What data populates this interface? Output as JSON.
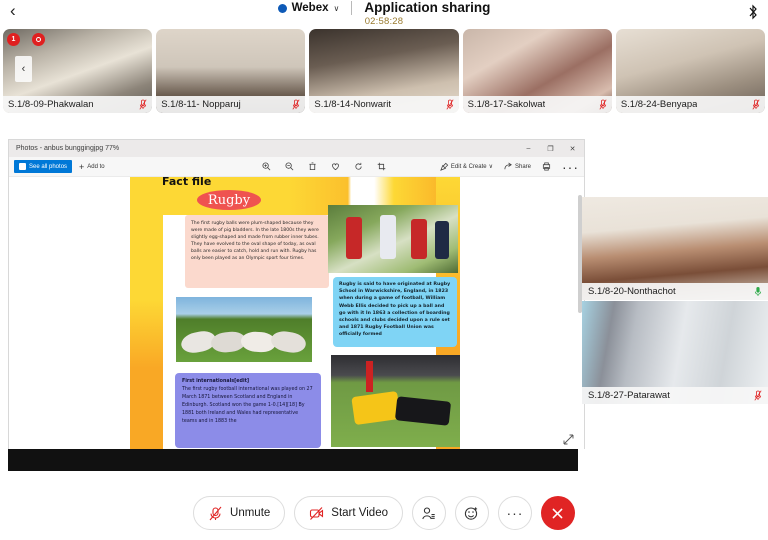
{
  "topbar": {
    "back_icon": "chevron-left-icon",
    "app_name": "Webex",
    "caret": "∨",
    "title": "Application sharing",
    "timer": "02:58:28",
    "bluetooth_icon": "bluetooth-icon"
  },
  "thumbnails": {
    "prev_label": "‹",
    "badge_count": "1",
    "items": [
      {
        "name": "S.1/8-09-Phakwalan",
        "mic": "muted"
      },
      {
        "name": "S.1/8-11- Nopparuj",
        "mic": "muted"
      },
      {
        "name": "S.1/8-14-Nonwarit",
        "mic": "muted"
      },
      {
        "name": "S.1/8-17-Sakolwat",
        "mic": "muted"
      },
      {
        "name": "S.1/8-24-Benyapa",
        "mic": "muted"
      }
    ]
  },
  "share_window": {
    "title": "Photos - anbus bunggingjpg   77%",
    "minimize": "–",
    "maximize": "❐",
    "close": "✕",
    "toolbar": {
      "see_all_photos": "See all photos",
      "add_to": "Add to",
      "edit_create": "Edit & Create",
      "edit_create_caret": "∨",
      "share": "Share",
      "icons": [
        "zoom-in-icon",
        "zoom-out-icon",
        "delete-icon",
        "heart-icon",
        "rotate-icon",
        "crop-icon",
        "print-icon",
        "more-icon"
      ]
    }
  },
  "poster": {
    "header": "Fact file",
    "title": "Rugby",
    "pink_text": "The first rugby balls were plum-shaped because they were made of pig bladders. In the late 1800s they were slightly egg-shaped and made from rubber inner tubes. They have evolved to the oval shape of today, as oval balls are easier to catch, hold and run with. Rugby has only been played as an Olympic sport four times.",
    "blue_text": "Rugby is said to have originated at Rugby School in Warwickshire, England, in 1823 when during a game of football, William Webb Ellis decided to pick up a ball and go with it In 1863 a collection of boarding schools and clubs decided upon a rule set and 1871 Rugby Football Union was officially formed",
    "purple_heading": "First internationals[edit]",
    "purple_text": "The first rugby football international was played on 27 March 1871 between Scotland and England in Edinburgh. Scotland won the game 1-0.[14][18] By 1881 both Ireland and Wales had representative teams and in 1883 the"
  },
  "right_panel": {
    "items": [
      {
        "name": "S.1/8-20-Nonthachot",
        "mic": "active"
      },
      {
        "name": "S.1/8-27-Patarawat",
        "mic": "muted"
      }
    ]
  },
  "bottom_controls": {
    "unmute": "Unmute",
    "start_video": "Start Video",
    "participants_icon": "participants-icon",
    "reactions_icon": "reactions-icon",
    "more_label": "···",
    "end_icon": "end-call-icon"
  },
  "colors": {
    "brand_blue": "#0e5ab7",
    "end_red": "#e02424",
    "muted_red": "#e02424",
    "active_green": "#2faa4a",
    "timer_gold": "#9a7b2f",
    "win_blue": "#0078d7"
  }
}
